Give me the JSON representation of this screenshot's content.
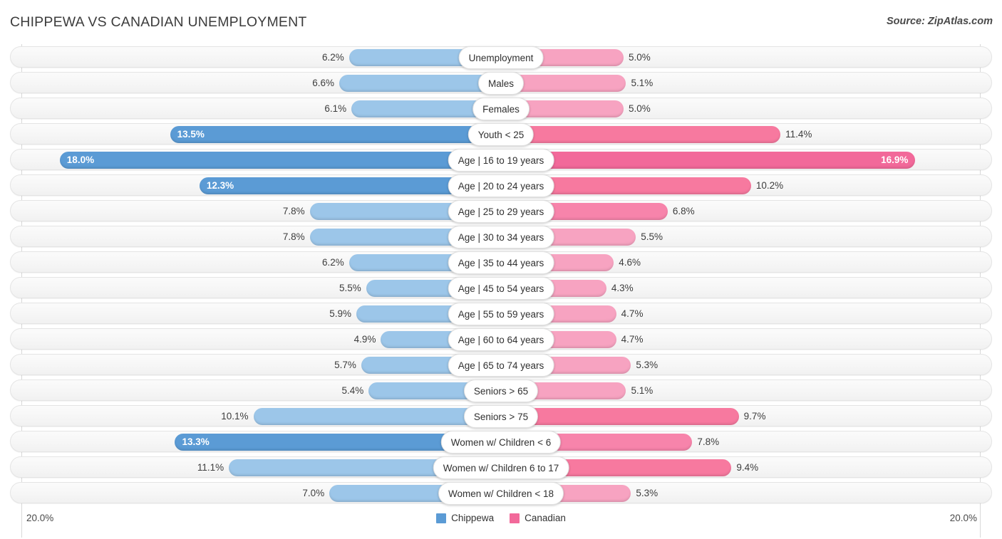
{
  "header": {
    "title": "CHIPPEWA VS CANADIAN UNEMPLOYMENT",
    "source": "Source: ZipAtlas.com"
  },
  "legend": {
    "items": [
      {
        "label": "Chippewa",
        "color": "#5b9bd5"
      },
      {
        "label": "Canadian",
        "color": "#f2699a"
      }
    ]
  },
  "axis": {
    "left_label": "20.0%",
    "right_label": "20.0%",
    "max": 20.0
  },
  "chart_data": {
    "type": "bar",
    "orientation": "horizontal-diverging",
    "title": "CHIPPEWA VS CANADIAN UNEMPLOYMENT",
    "xlabel": "",
    "ylabel": "",
    "xlim": [
      0,
      20.0
    ],
    "grid": false,
    "legend_position": "bottom-center",
    "categories": [
      "Unemployment",
      "Males",
      "Females",
      "Youth < 25",
      "Age | 16 to 19 years",
      "Age | 20 to 24 years",
      "Age | 25 to 29 years",
      "Age | 30 to 34 years",
      "Age | 35 to 44 years",
      "Age | 45 to 54 years",
      "Age | 55 to 59 years",
      "Age | 60 to 64 years",
      "Age | 65 to 74 years",
      "Seniors > 65",
      "Seniors > 75",
      "Women w/ Children < 6",
      "Women w/ Children 6 to 17",
      "Women w/ Children < 18"
    ],
    "series": [
      {
        "name": "Chippewa",
        "color": "#5b9bd5",
        "values": [
          6.2,
          6.6,
          6.1,
          13.5,
          18.0,
          12.3,
          7.8,
          7.8,
          6.2,
          5.5,
          5.9,
          4.9,
          5.7,
          5.4,
          10.1,
          13.3,
          11.1,
          7.0
        ],
        "labels": [
          "6.2%",
          "6.6%",
          "6.1%",
          "13.5%",
          "18.0%",
          "12.3%",
          "7.8%",
          "7.8%",
          "6.2%",
          "5.5%",
          "5.9%",
          "4.9%",
          "5.7%",
          "5.4%",
          "10.1%",
          "13.3%",
          "11.1%",
          "7.0%"
        ]
      },
      {
        "name": "Canadian",
        "color": "#f2699a",
        "values": [
          5.0,
          5.1,
          5.0,
          11.4,
          16.9,
          10.2,
          6.8,
          5.5,
          4.6,
          4.3,
          4.7,
          4.7,
          5.3,
          5.1,
          9.7,
          7.8,
          9.4,
          5.3
        ],
        "labels": [
          "5.0%",
          "5.1%",
          "5.0%",
          "11.4%",
          "16.9%",
          "10.2%",
          "6.8%",
          "5.5%",
          "4.6%",
          "4.3%",
          "4.7%",
          "4.7%",
          "5.3%",
          "5.1%",
          "9.7%",
          "7.8%",
          "9.4%",
          "5.3%"
        ]
      }
    ]
  }
}
